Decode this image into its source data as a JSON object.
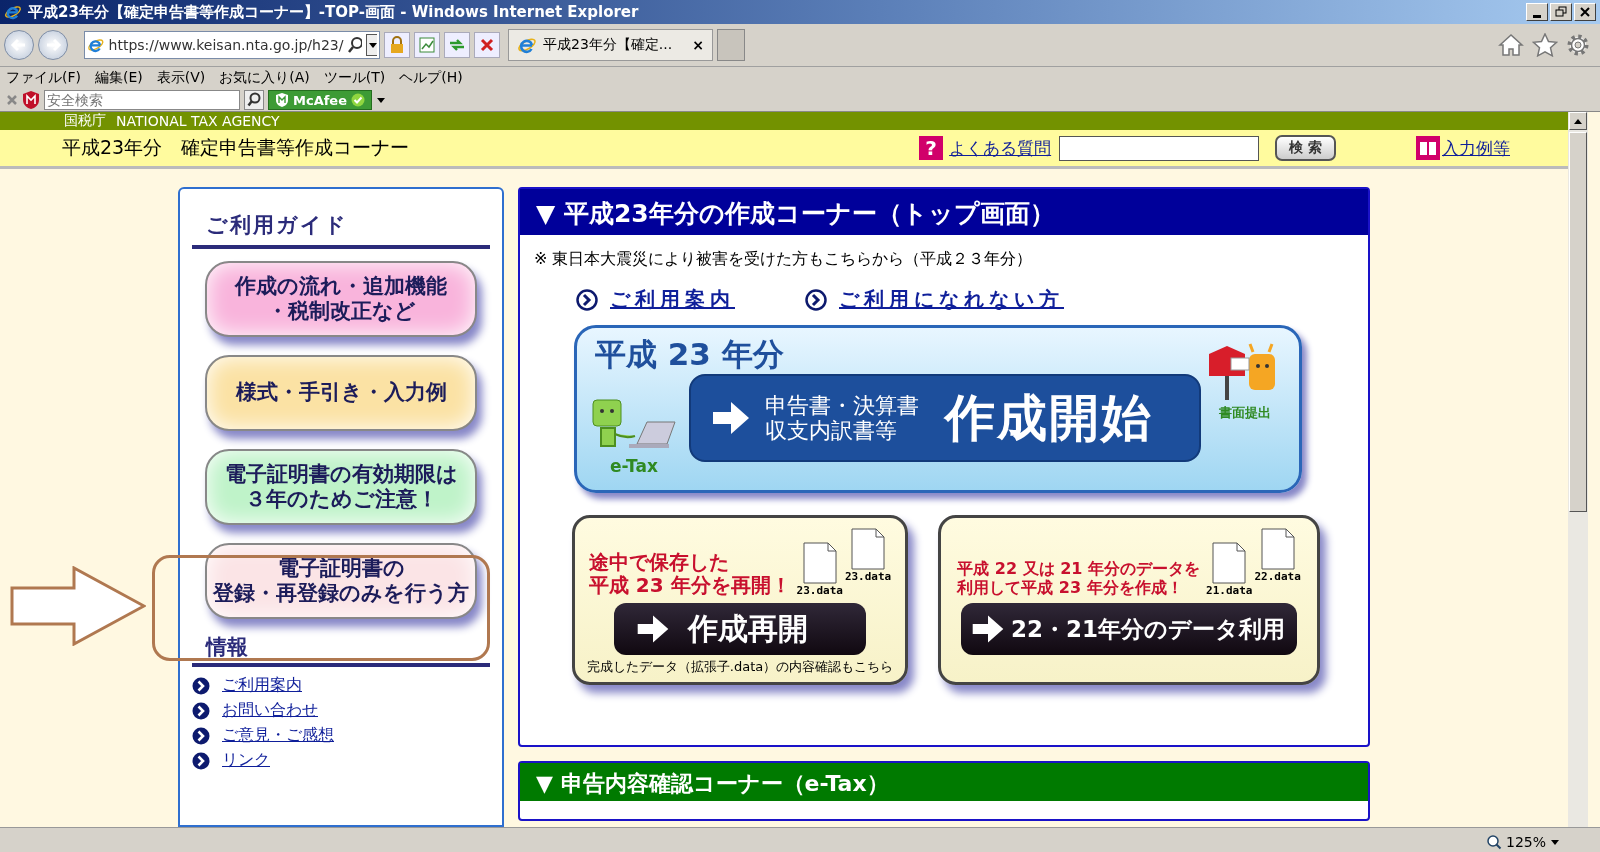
{
  "window": {
    "title": "平成23年分【確定申告書等作成コーナー】-TOP-画面 - Windows Internet Explorer"
  },
  "address_bar": {
    "url": "https://www.keisan.nta.go.jp/h23/"
  },
  "tab": {
    "title": "平成23年分【確定...",
    "close": "×"
  },
  "menu": [
    "ファイル(F)",
    "編集(E)",
    "表示(V)",
    "お気に入り(A)",
    "ツール(T)",
    "ヘルプ(H)"
  ],
  "search_toolbar": {
    "placeholder": "安全検索",
    "brand": "McAfee"
  },
  "site_strip": {
    "agency": "国税庁",
    "agency_en": "NATIONAL TAX AGENCY"
  },
  "header": {
    "title": "平成23年分　確定申告書等作成コーナー",
    "faq_icon": "?",
    "faq_link": "よくある質問",
    "search_button": "検 索",
    "examples_link": "入力例等"
  },
  "sidebar": {
    "guide_heading": "ご利用ガイド",
    "guide_buttons": [
      {
        "label_lines": [
          "作成の流れ・追加機能",
          "・税制改正など"
        ],
        "color": "#f9b4dc"
      },
      {
        "label_lines": [
          "様式・手引き・入力例"
        ],
        "color": "#fbe2a4"
      },
      {
        "label_lines": [
          "電子証明書の有効期限は",
          "３年のためご注意！"
        ],
        "color": "#bff3c9"
      },
      {
        "label_lines": [
          "電子証明書の",
          "登録・再登録のみを行う方"
        ],
        "color": "#fbe4e6"
      }
    ],
    "info_heading": "情報",
    "info_links": [
      "ご利用案内",
      "お問い合わせ",
      "ご意見・ご感想",
      "リンク"
    ]
  },
  "main_panel": {
    "title": "▼ 平成23年分の作成コーナー（トップ画面）",
    "notice": "※ 東日本大震災により被害を受けた方もこちらから（平成２３年分）",
    "links": [
      "ご利用案内",
      "ご利用になれない方"
    ],
    "start_banner": {
      "year": "平成 23 年分",
      "subtitle_lines": [
        "申告書・決算書",
        "収支内訳書等"
      ],
      "action": "作成開始",
      "etax_label": "e-Tax",
      "paper_label": "書面提出"
    },
    "cards": [
      {
        "headline_lines": [
          "途中で保存した",
          "平成 23 年分を再開！"
        ],
        "files": [
          "23.data",
          "23.data"
        ],
        "button": "作成再開",
        "note": "完成したデータ（拡張子.data）の内容確認もこちら"
      },
      {
        "headline_lines": [
          "平成 22 又は 21 年分のデータを",
          "利用して平成 23 年分を作成！"
        ],
        "files": [
          "21.data",
          "22.data"
        ],
        "button": "22・21年分のデータ利用"
      }
    ]
  },
  "second_panel": {
    "title": "▼ 申告内容確認コーナー（e-Tax）"
  },
  "status_bar": {
    "zoom": "125%"
  }
}
